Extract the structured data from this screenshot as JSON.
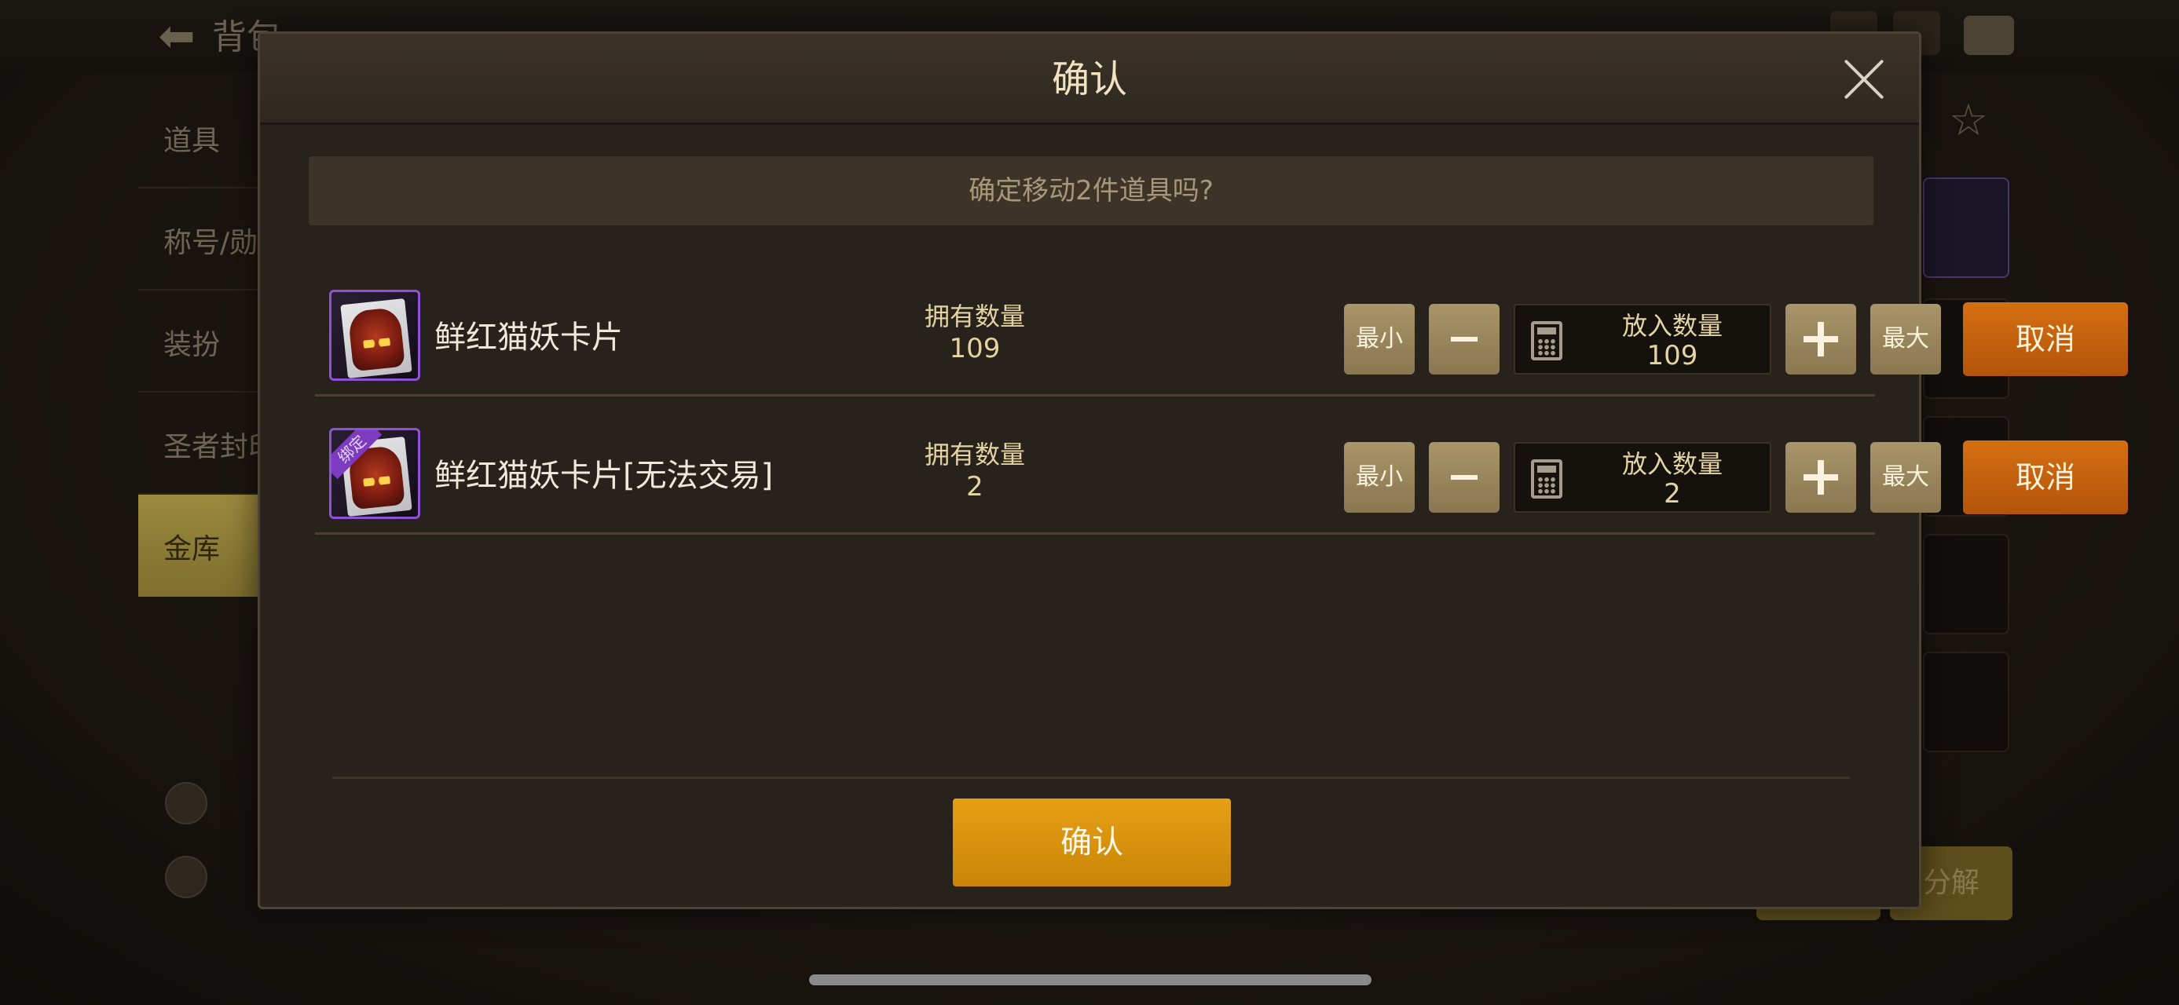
{
  "background": {
    "back_label": "背包",
    "sidebar_items": [
      "道具",
      "称号/勋章",
      "装扮",
      "圣者封印",
      "金库"
    ],
    "active_sidebar_item": "金库",
    "decompose_label": "分解"
  },
  "modal": {
    "title": "确认",
    "question": "确定移动2件道具吗?",
    "owned_label": "拥有数量",
    "put_label": "放入数量",
    "min_label": "最小",
    "max_label": "最大",
    "cancel_label": "取消",
    "confirm_label": "确认",
    "items": [
      {
        "name": "鲜红猫妖卡片",
        "owned": "109",
        "put": "109",
        "bound": false
      },
      {
        "name": "鲜红猫妖卡片[无法交易]",
        "owned": "2",
        "put": "2",
        "bound": true,
        "bind_tag": "绑定"
      }
    ]
  },
  "colors": {
    "accent_gold": "#d99212",
    "cancel_orange": "#c8620e",
    "item_rarity_purple": "#8f52d6"
  }
}
